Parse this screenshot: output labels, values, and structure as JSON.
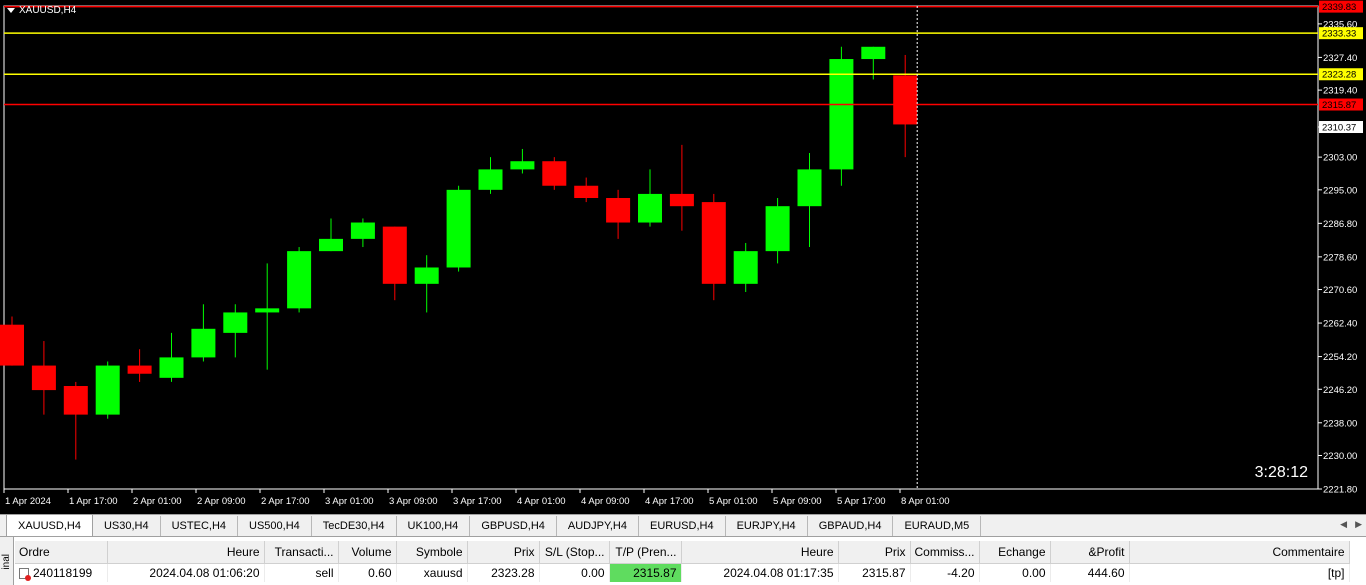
{
  "chart": {
    "symbol_label": "XAUUSD,H4",
    "timer": "3:28:12",
    "y_min": 2221.8,
    "y_max": 2339.0,
    "price_ticks": [
      "2335.60",
      "2327.40",
      "2319.40",
      "2310.37",
      "2303.00",
      "2295.00",
      "2286.80",
      "2278.60",
      "2270.60",
      "2262.40",
      "2254.20",
      "2246.20",
      "2238.00",
      "2230.00",
      "2221.80"
    ],
    "horizontal_lines": [
      {
        "price": 2339.83,
        "label": "2339.83",
        "color": "#ff0000",
        "label_bg": "#ff0000",
        "label_fg": "#000000"
      },
      {
        "price": 2333.33,
        "label": "2333.33",
        "color": "#ffff00",
        "label_bg": "#ffff00",
        "label_fg": "#000000"
      },
      {
        "price": 2323.28,
        "label": "2323.28",
        "color": "#ffff00",
        "label_bg": "#ffff00",
        "label_fg": "#000000"
      },
      {
        "price": 2315.87,
        "label": "2315.87",
        "color": "#ff0000",
        "label_bg": "#ff0000",
        "label_fg": "#000000"
      }
    ],
    "current_price": {
      "price": 2310.37,
      "label": "2310.37"
    },
    "time_labels": [
      "1 Apr 2024",
      "1 Apr 17:00",
      "2 Apr 01:00",
      "2 Apr 09:00",
      "2 Apr 17:00",
      "3 Apr 01:00",
      "3 Apr 09:00",
      "3 Apr 17:00",
      "4 Apr 01:00",
      "4 Apr 09:00",
      "4 Apr 17:00",
      "5 Apr 01:00",
      "5 Apr 09:00",
      "5 Apr 17:00",
      "8 Apr 01:00"
    ],
    "up_color": "#00ff00",
    "down_color": "#ff0000"
  },
  "chart_data": {
    "type": "candlestick",
    "title": "XAUUSD,H4",
    "ylim": [
      2221.8,
      2339.0
    ],
    "candles": [
      {
        "o": 2262,
        "h": 2264,
        "l": 2252,
        "c": 2252
      },
      {
        "o": 2252,
        "h": 2258,
        "l": 2240,
        "c": 2246
      },
      {
        "o": 2247,
        "h": 2248,
        "l": 2229,
        "c": 2240
      },
      {
        "o": 2240,
        "h": 2253,
        "l": 2239,
        "c": 2252
      },
      {
        "o": 2252,
        "h": 2256,
        "l": 2248,
        "c": 2250
      },
      {
        "o": 2249,
        "h": 2260,
        "l": 2248,
        "c": 2254
      },
      {
        "o": 2254,
        "h": 2267,
        "l": 2253,
        "c": 2261
      },
      {
        "o": 2260,
        "h": 2267,
        "l": 2254,
        "c": 2265
      },
      {
        "o": 2265,
        "h": 2277,
        "l": 2251,
        "c": 2266
      },
      {
        "o": 2266,
        "h": 2281,
        "l": 2265,
        "c": 2280
      },
      {
        "o": 2280,
        "h": 2288,
        "l": 2280,
        "c": 2283
      },
      {
        "o": 2283,
        "h": 2288,
        "l": 2281,
        "c": 2287
      },
      {
        "o": 2286,
        "h": 2286,
        "l": 2268,
        "c": 2272
      },
      {
        "o": 2272,
        "h": 2279,
        "l": 2265,
        "c": 2276
      },
      {
        "o": 2276,
        "h": 2296,
        "l": 2275,
        "c": 2295
      },
      {
        "o": 2295,
        "h": 2303,
        "l": 2294,
        "c": 2300
      },
      {
        "o": 2300,
        "h": 2305,
        "l": 2299,
        "c": 2302
      },
      {
        "o": 2302,
        "h": 2303,
        "l": 2295,
        "c": 2296
      },
      {
        "o": 2296,
        "h": 2298,
        "l": 2292,
        "c": 2293
      },
      {
        "o": 2293,
        "h": 2295,
        "l": 2283,
        "c": 2287
      },
      {
        "o": 2287,
        "h": 2300,
        "l": 2286,
        "c": 2294
      },
      {
        "o": 2294,
        "h": 2306,
        "l": 2285,
        "c": 2291
      },
      {
        "o": 2292,
        "h": 2294,
        "l": 2268,
        "c": 2272
      },
      {
        "o": 2272,
        "h": 2282,
        "l": 2270,
        "c": 2280
      },
      {
        "o": 2280,
        "h": 2293,
        "l": 2277,
        "c": 2291
      },
      {
        "o": 2291,
        "h": 2304,
        "l": 2281,
        "c": 2300
      },
      {
        "o": 2300,
        "h": 2330,
        "l": 2296,
        "c": 2327
      },
      {
        "o": 2327,
        "h": 2330,
        "l": 2322,
        "c": 2330
      },
      {
        "o": 2323,
        "h": 2328,
        "l": 2303,
        "c": 2311
      }
    ]
  },
  "tabs": [
    "XAUUSD,H4",
    "US30,H4",
    "USTEC,H4",
    "US500,H4",
    "TecDE30,H4",
    "UK100,H4",
    "GBPUSD,H4",
    "AUDJPY,H4",
    "EURUSD,H4",
    "EURJPY,H4",
    "GBPAUD,H4",
    "EURAUD,M5"
  ],
  "terminal": {
    "side_label": "inal",
    "headers": [
      "Ordre",
      "Heure",
      "Transacti...",
      "Volume",
      "Symbole",
      "Prix",
      "S/L (Stop...",
      "T/P (Pren...",
      "Heure",
      "Prix",
      "Commiss...",
      "Echange",
      "&Profit",
      "Commentaire"
    ],
    "row": [
      "240118199",
      "2024.04.08 01:06:20",
      "sell",
      "0.60",
      "xauusd",
      "2323.28",
      "0.00",
      "2315.87",
      "2024.04.08 01:17:35",
      "2315.87",
      "-4.20",
      "0.00",
      "444.60",
      "[tp]"
    ]
  }
}
